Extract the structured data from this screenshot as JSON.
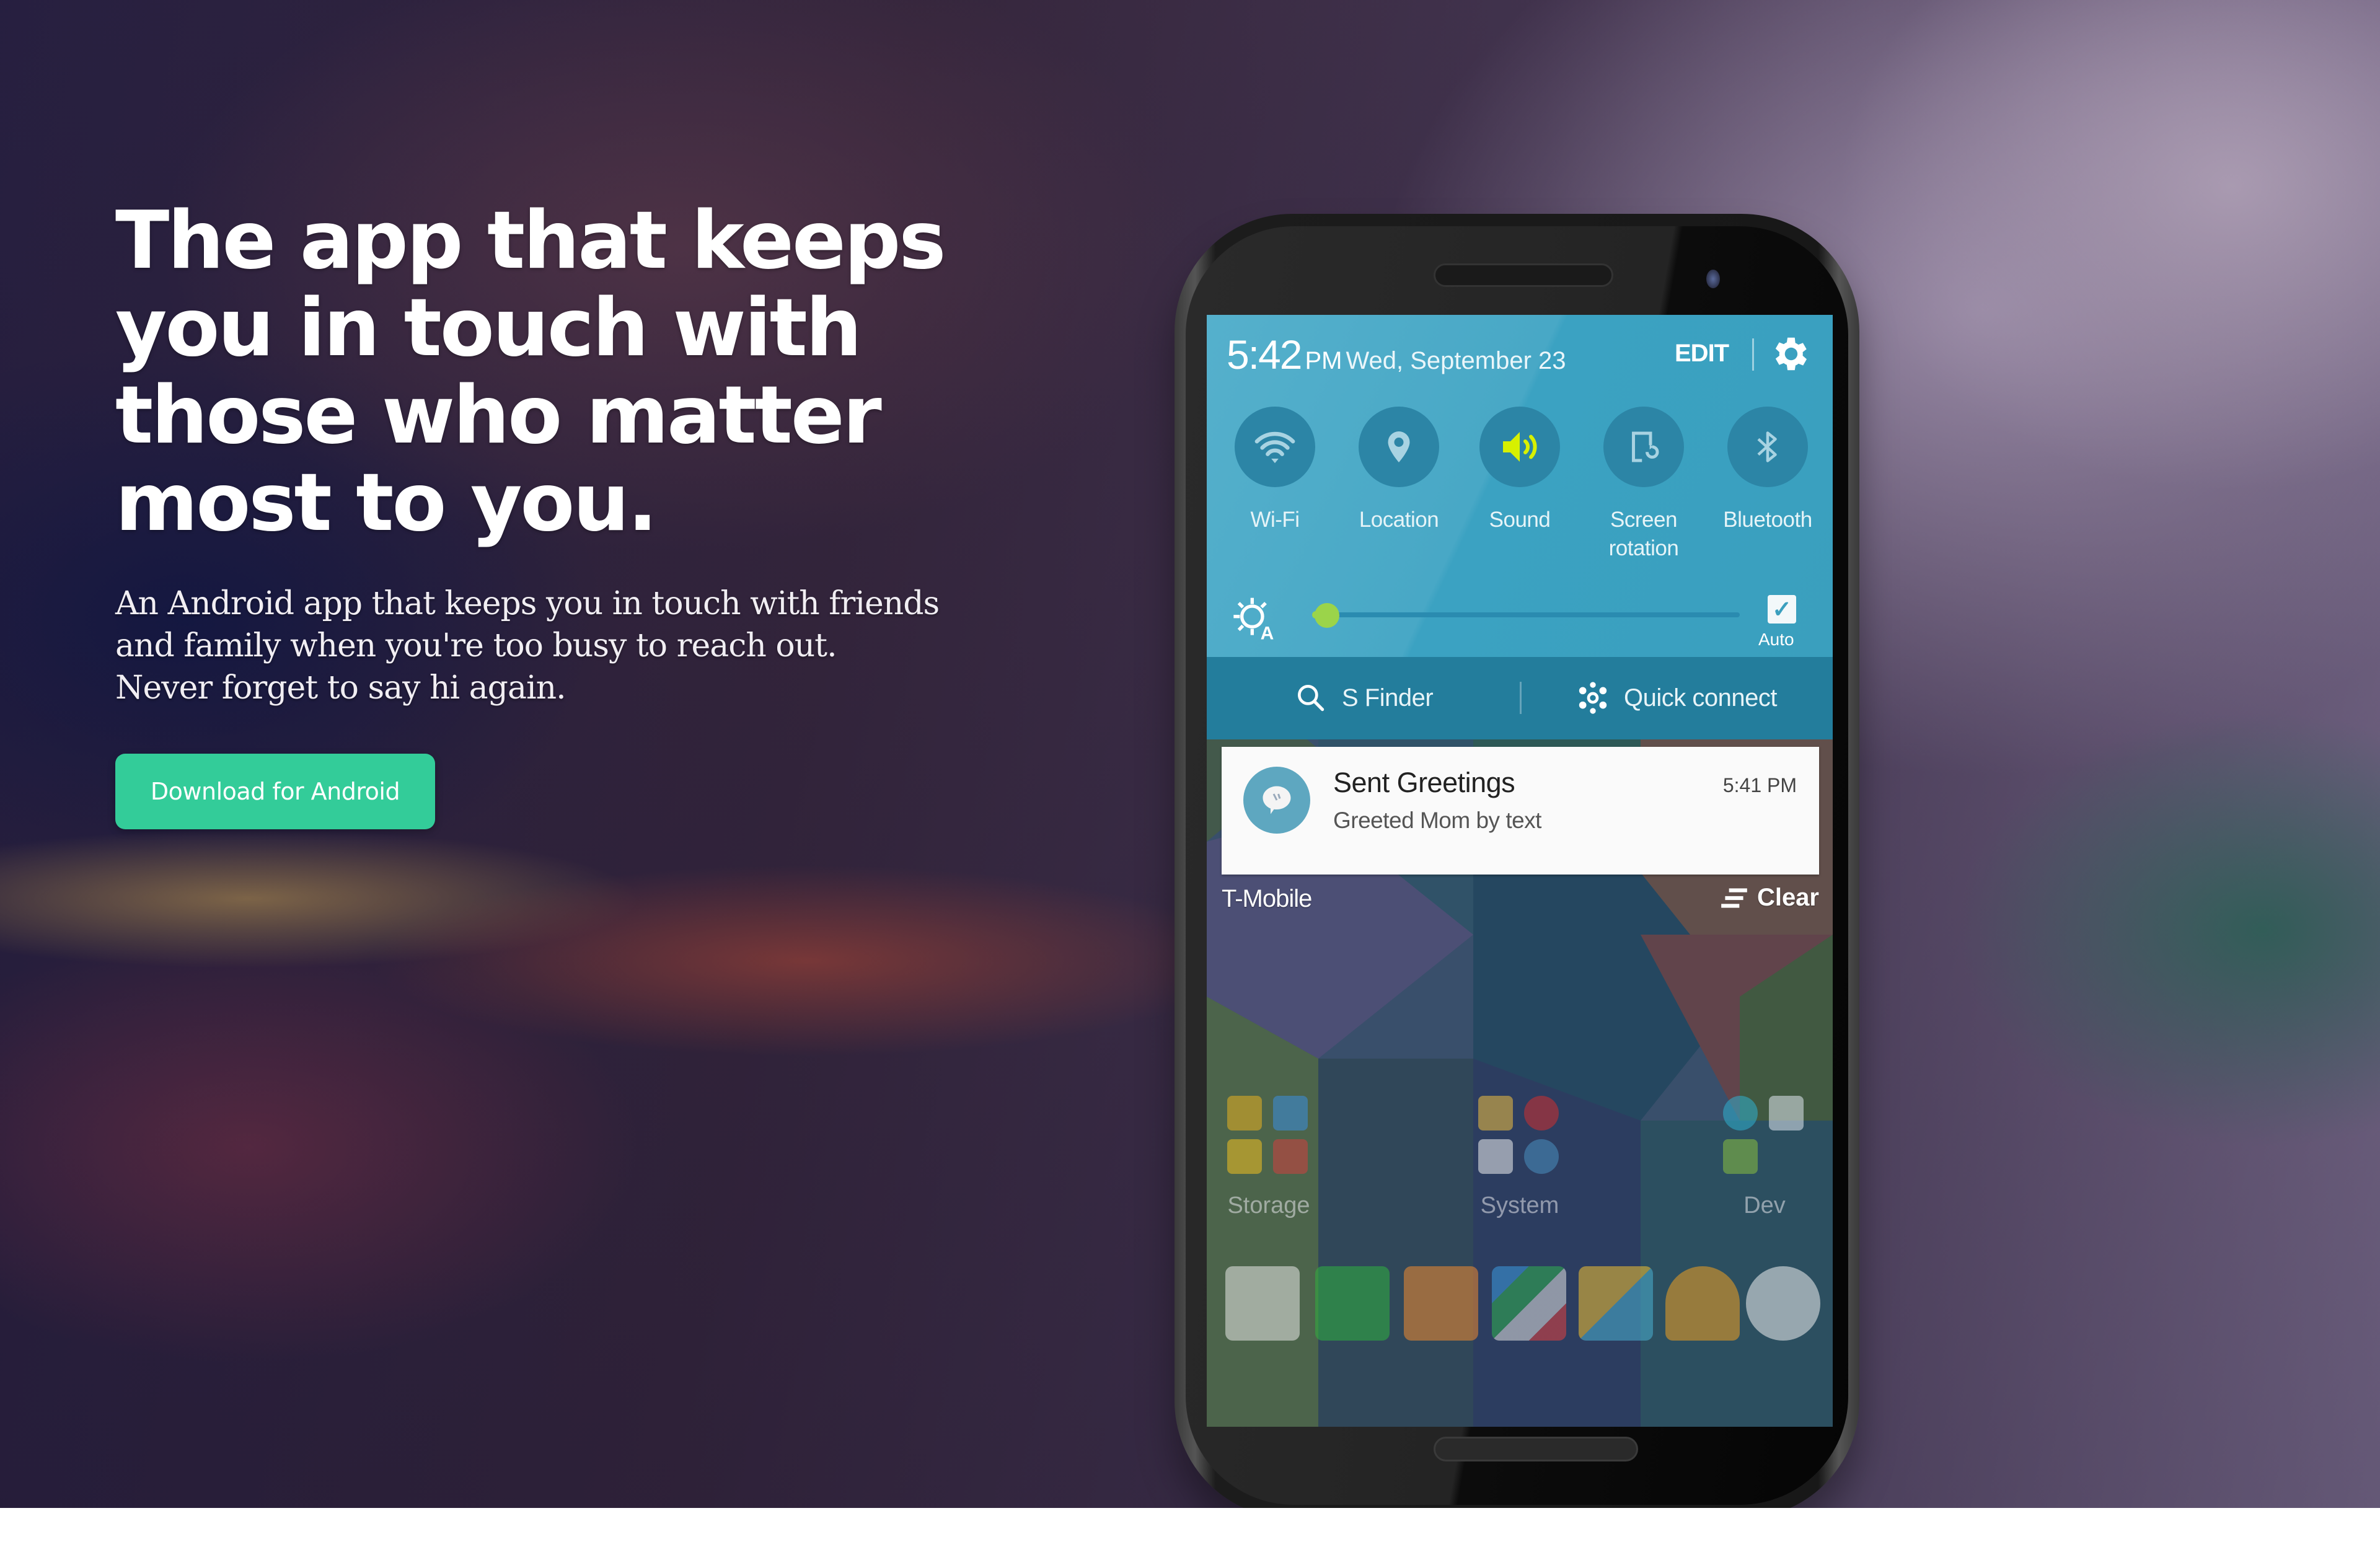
{
  "hero": {
    "headline_lines": [
      "The app that keeps",
      "you in touch with",
      "those who matter",
      "most to you."
    ],
    "subtitle_lines": [
      "An Android app that keeps you in touch with friends",
      "and family when you're too busy to reach out.",
      "Never forget to say hi again."
    ],
    "cta_label": "Download for Android",
    "cta_color": "#33cc99"
  },
  "phone": {
    "status": {
      "time": "5:42",
      "ampm": "PM",
      "date": "Wed, September 23",
      "edit_label": "EDIT",
      "settings_icon": "gear-icon"
    },
    "toggles": [
      {
        "label": "Wi-Fi",
        "icon": "wifi-icon",
        "active": false
      },
      {
        "label": "Location",
        "icon": "location-pin-icon",
        "active": false
      },
      {
        "label": "Sound",
        "icon": "speaker-icon",
        "active": true
      },
      {
        "label": "Screen\nrotation",
        "label_line1": "Screen",
        "label_line2": "rotation",
        "icon": "screen-rotation-icon",
        "active": false
      },
      {
        "label": "Bluetooth",
        "icon": "bluetooth-icon",
        "active": false
      }
    ],
    "brightness": {
      "level_fraction": 0.01,
      "auto_label": "Auto",
      "auto_checked": true,
      "icon": "auto-brightness-icon"
    },
    "finder": {
      "s_finder_label": "S Finder",
      "quick_connect_label": "Quick connect"
    },
    "notification": {
      "title": "Sent Greetings",
      "body": "Greeted Mom by text",
      "time": "5:41 PM",
      "icon": "chat-bubble-icon"
    },
    "carrier": "T-Mobile",
    "clear_label": "Clear",
    "folders": [
      {
        "label": "Storage"
      },
      {
        "label": "System"
      },
      {
        "label": "Dev"
      }
    ],
    "dock": [
      "play-store-icon",
      "phone-icon",
      "contacts-icon",
      "apps-cluster-icon",
      "apps-cluster-icon-2",
      "play-music-icon",
      "app-drawer-icon"
    ],
    "accent_colors": {
      "panel": "#3ba2c2",
      "toggle_bg": "#2c85a6",
      "sound_active": "#d7f000",
      "slider": "#9bd44a"
    }
  }
}
